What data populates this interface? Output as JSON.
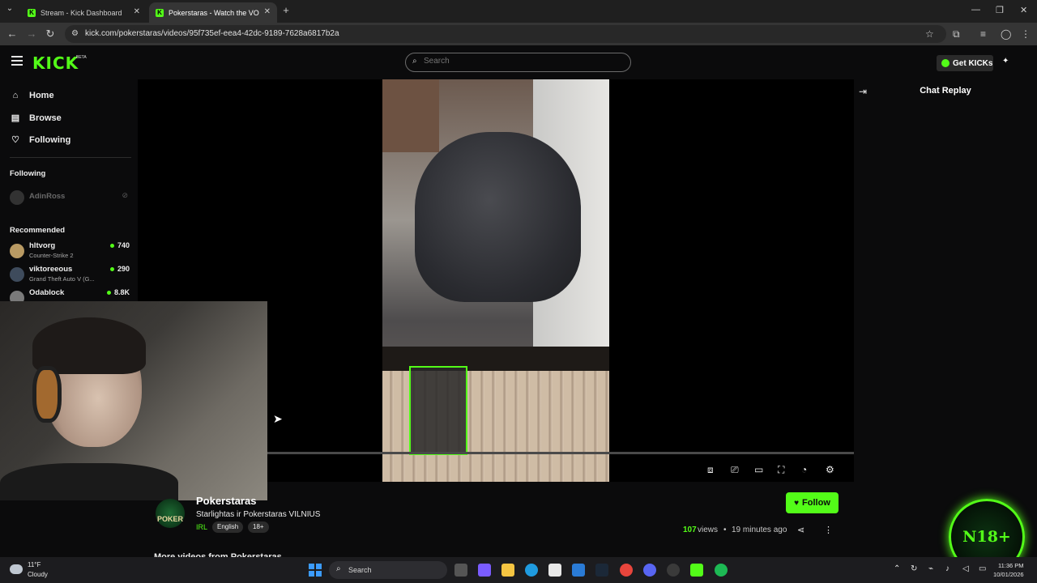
{
  "browser": {
    "tabs": [
      {
        "title": "Stream - Kick Dashboard",
        "active": false
      },
      {
        "title": "Pokerstaras - Watch the VOD o",
        "active": true
      }
    ],
    "url": "kick.com/pokerstaras/videos/95f735ef-eea4-42dc-9189-7628a6817b2a"
  },
  "header": {
    "logo": "KICK",
    "logo_badge": "BETA",
    "search_placeholder": "Search",
    "get_kicks_label": "Get KICKs"
  },
  "sidebar": {
    "nav": [
      {
        "label": "Home",
        "icon": "home-icon"
      },
      {
        "label": "Browse",
        "icon": "browse-icon"
      },
      {
        "label": "Following",
        "icon": "heart-icon"
      }
    ],
    "following_title": "Following",
    "following": [
      {
        "name": "AdinRoss",
        "offline": true
      }
    ],
    "recommended_title": "Recommended",
    "recommended": [
      {
        "name": "hltvorg",
        "category": "Counter-Strike 2",
        "viewers": "740"
      },
      {
        "name": "viktoreeous",
        "category": "Grand Theft Auto V (G...",
        "viewers": "290"
      },
      {
        "name": "Odablock",
        "category": "",
        "viewers": "8.8K"
      }
    ]
  },
  "video": {
    "channel_name": "Pokerstaras",
    "avatar_text": "POKER",
    "title": "Starlightas ir Pokerstaras VILNIUS",
    "category": "IRL",
    "tags": [
      "English",
      "18+"
    ],
    "follow_label": "Follow",
    "views_count": "107",
    "views_label": "views",
    "separator": "•",
    "time_ago": "19 minutes ago",
    "more_videos_heading": "More videos from Pokerstaras"
  },
  "chat": {
    "title": "Chat Replay"
  },
  "overlay": {
    "badge_text": "N18+"
  },
  "taskbar": {
    "weather_temp": "11°F",
    "weather_desc": "Cloudy",
    "search_label": "Search",
    "time": "11:36 PM",
    "date": "10/01/2026"
  },
  "colors": {
    "accent": "#53fc18",
    "background": "#0b0b0c"
  }
}
